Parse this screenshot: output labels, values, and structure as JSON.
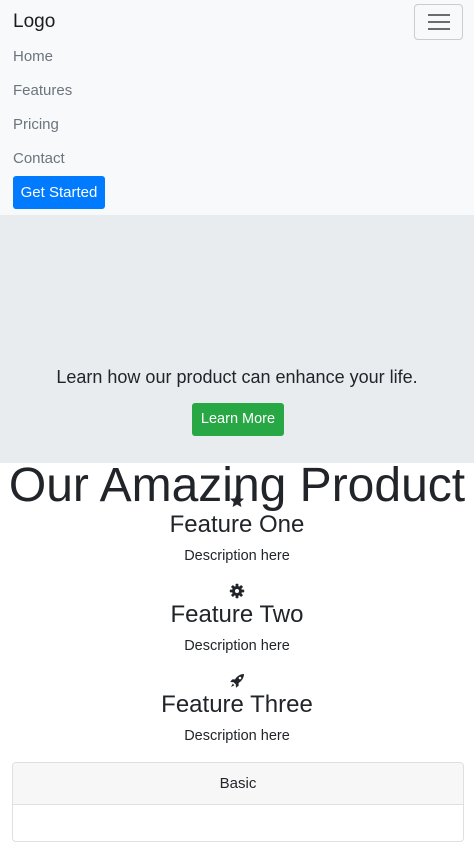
{
  "navbar": {
    "brand": "Logo",
    "toggle_icon": "hamburger-menu-icon",
    "links": [
      {
        "label": "Home"
      },
      {
        "label": "Features"
      },
      {
        "label": "Pricing"
      },
      {
        "label": "Contact"
      }
    ],
    "cta_label": "Get Started"
  },
  "hero": {
    "title": "Our Amazing Product",
    "lead": "Learn how our product can enhance your life.",
    "button_label": "Learn More"
  },
  "features": [
    {
      "icon": "star-icon",
      "title": "Feature One",
      "description": "Description here"
    },
    {
      "icon": "gear-icon",
      "title": "Feature Two",
      "description": "Description here"
    },
    {
      "icon": "rocket-icon",
      "title": "Feature Three",
      "description": "Description here"
    }
  ],
  "pricing": {
    "cards": [
      {
        "title": "Basic"
      }
    ]
  },
  "colors": {
    "primary": "#007bff",
    "success": "#28a745",
    "navbar_bg": "#f8f9fa",
    "hero_bg": "#e9ecef"
  }
}
